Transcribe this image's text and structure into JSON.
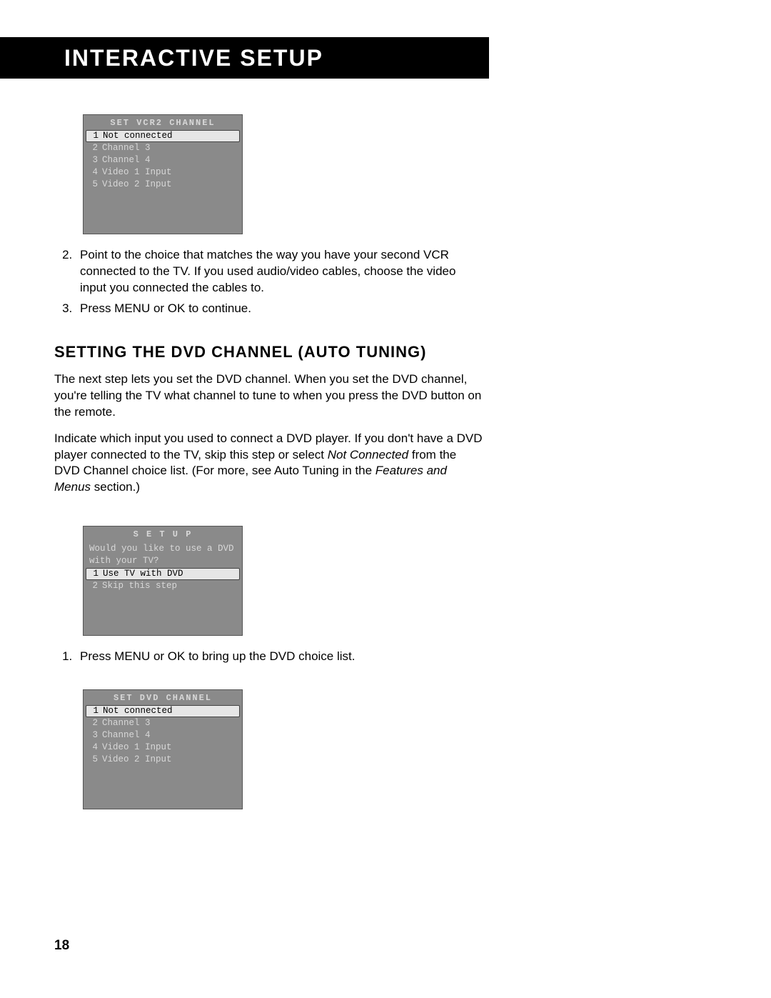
{
  "banner": {
    "title": "Interactive Setup"
  },
  "osd_vcr2": {
    "title": "SET  VCR2  CHANNEL",
    "items": [
      {
        "num": "1",
        "text": "Not connected",
        "highlight": true
      },
      {
        "num": "2",
        "text": "Channel 3"
      },
      {
        "num": "3",
        "text": "Channel 4"
      },
      {
        "num": "4",
        "text": "Video 1 Input"
      },
      {
        "num": "5",
        "text": "Video 2 Input"
      }
    ]
  },
  "steps_a_start": 2,
  "steps_a": [
    "Point to the choice that matches the way you have your second VCR connected to the TV.  If you used audio/video cables, choose the video input you connected the cables to.",
    "Press MENU or OK to continue."
  ],
  "section_heading": "Setting the DVD Channel (Auto Tuning)",
  "para1_parts": {
    "p": "The next step lets you set the DVD channel. When you set the DVD channel, you're telling the TV what channel to tune to when you press the DVD button on the remote."
  },
  "para2_parts": {
    "a": "Indicate which input you used to connect a DVD player. If you don't have a DVD player connected to the TV, skip this step or select ",
    "i1": "Not Connected",
    "b": " from the DVD Channel choice list. (For more, see Auto Tuning in the ",
    "i2": "Features and Menus",
    "c": " section.)"
  },
  "osd_setup": {
    "title": "S E T U P",
    "prompt": "Would you like to use a DVD with your TV?",
    "items": [
      {
        "num": "1",
        "text": "Use TV with DVD",
        "highlight": true
      },
      {
        "num": "2",
        "text": "Skip this step"
      }
    ]
  },
  "steps_b_start": 1,
  "steps_b": [
    "Press MENU or OK to bring up the DVD choice list."
  ],
  "osd_dvd": {
    "title": "SET  DVD  CHANNEL",
    "items": [
      {
        "num": "1",
        "text": "Not connected",
        "highlight": true
      },
      {
        "num": "2",
        "text": "Channel 3"
      },
      {
        "num": "3",
        "text": "Channel 4"
      },
      {
        "num": "4",
        "text": "Video 1 Input"
      },
      {
        "num": "5",
        "text": "Video 2 Input"
      }
    ]
  },
  "page_number": "18"
}
